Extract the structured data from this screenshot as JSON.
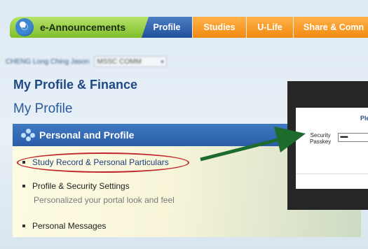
{
  "nav": {
    "announcements_label": "e-Announcements",
    "tabs": [
      {
        "label": "Profile"
      },
      {
        "label": "Studies"
      },
      {
        "label": "U-Life"
      },
      {
        "label": "Share & Comn"
      }
    ]
  },
  "user": {
    "name": "CHENG Long Ching Jason",
    "program": "MSSC COMM"
  },
  "page": {
    "title": "My Profile & Finance",
    "subtitle": "My Profile"
  },
  "section": {
    "title": "Personal and Profile",
    "items": [
      {
        "label": "Study Record & Personal Particulars"
      },
      {
        "label": "Profile & Security Settings",
        "description": "Personalized your portal look and feel"
      },
      {
        "label": "Personal Messages"
      }
    ]
  },
  "dialog": {
    "title": "Plea",
    "passkey_label_line1": "Security",
    "passkey_label_line2": "Passkey",
    "passkey_value": "•••••"
  },
  "colors": {
    "arrow": "#1e6b2e",
    "highlight_oval": "#c0262d",
    "nav_green": "#7fbe2b",
    "nav_blue": "#1f4f9a",
    "nav_orange": "#f18a10"
  }
}
